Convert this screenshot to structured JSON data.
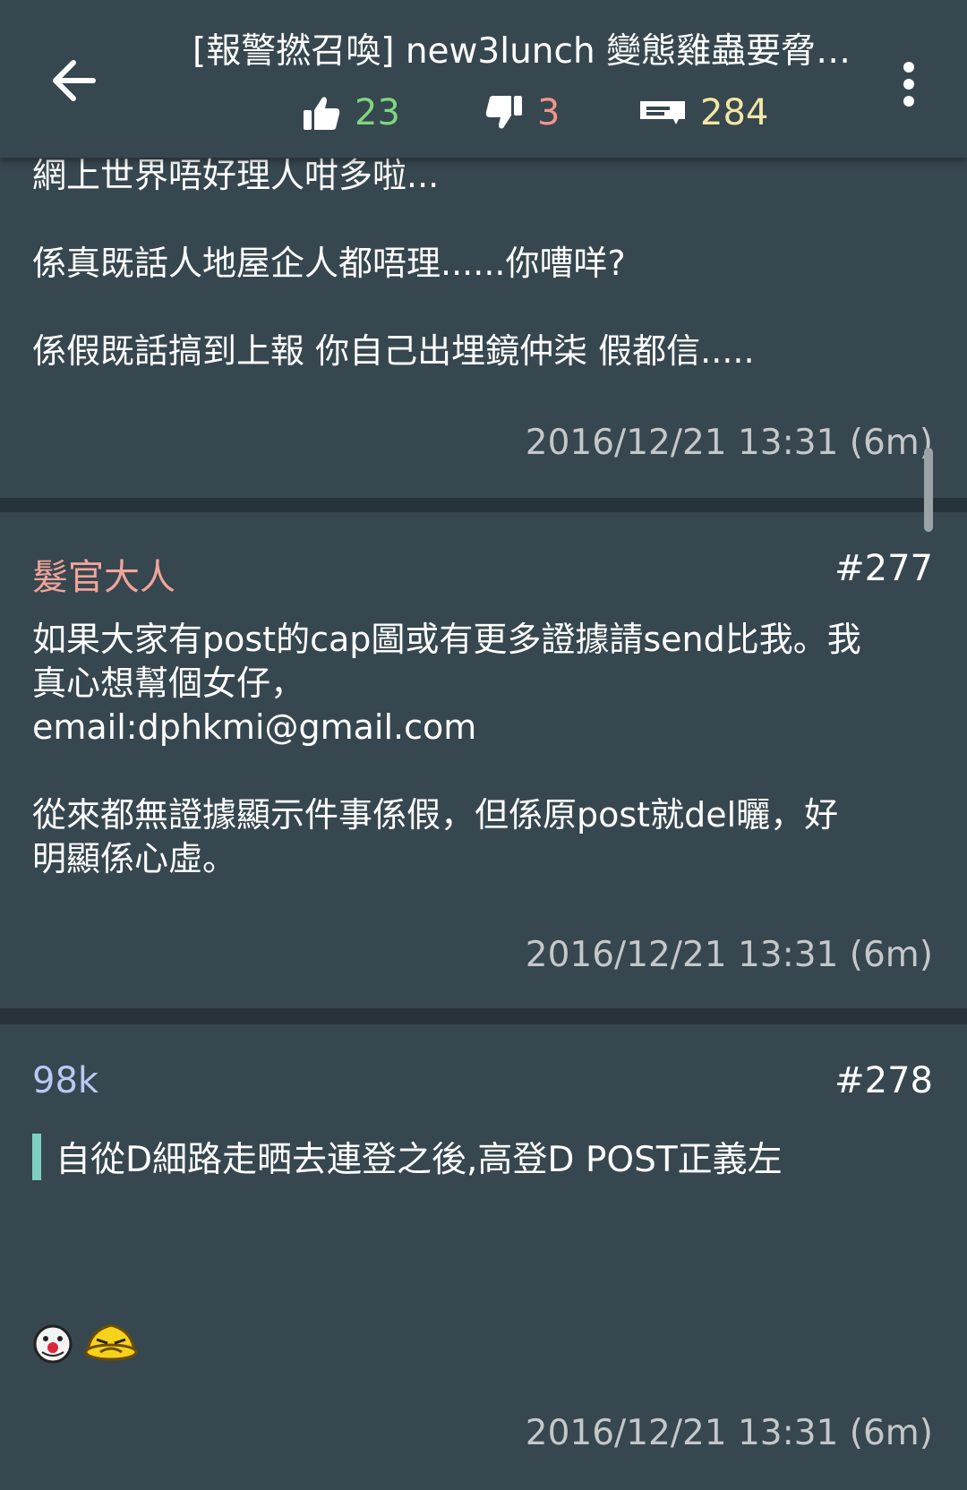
{
  "header": {
    "title": "[報警撚召喚] new3lunch 變態雞蟲要脅…",
    "likes": "23",
    "dislikes": "3",
    "replies": "284",
    "colors": {
      "likes": "#7ed67e",
      "dislikes": "#f2958a",
      "replies": "#f2e6a4"
    },
    "icons": {
      "back": "arrow-left-icon",
      "like": "thumbs-up-icon",
      "dislike": "thumbs-down-icon",
      "replies": "comment-icon",
      "menu": "more-vert-icon"
    }
  },
  "posts": [
    {
      "body": "網上世界唔好理人咁多啦...\n\n係真既話人地屋企人都唔理......你嘈咩?\n\n係假既話搞到上報 你自己出埋鏡仲柒 假都信.....",
      "time": "2016/12/21 13:31 (6m)"
    },
    {
      "author": "髮官大人",
      "author_color": "#f2a49a",
      "number": "#277",
      "body": "如果大家有post的cap圖或有更多證據請send比我。我\n真心想幫個女仔，\nemail:dphkmi@gmail.com\n\n從來都無證據顯示件事係假，但係原post就del曬，好\n明顯係心虛。",
      "time": "2016/12/21 13:31 (6m)"
    },
    {
      "author": "98k",
      "author_color": "#b9c8f4",
      "number": "#278",
      "quote": "自從D細路走晒去連登之後,高登D POST正義左",
      "emoticons": [
        "clown-face-emoticon",
        "yellow-face-emoticon"
      ],
      "time": "2016/12/21 13:31 (6m)"
    }
  ]
}
